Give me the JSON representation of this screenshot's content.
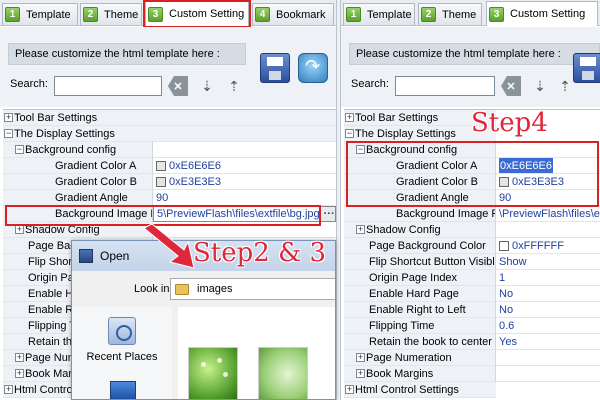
{
  "left": {
    "tabs": [
      {
        "num": "1",
        "label": "Template"
      },
      {
        "num": "2",
        "label": "Theme"
      },
      {
        "num": "3",
        "label": "Custom Setting"
      },
      {
        "num": "4",
        "label": "Bookmark"
      }
    ],
    "hint": "Please customize the html template here :",
    "search_label": "Search:",
    "search_value": "",
    "rows": [
      {
        "level": 0,
        "toggle": "+",
        "name": "Tool Bar Settings",
        "value": ""
      },
      {
        "level": 0,
        "toggle": "−",
        "name": "The Display Settings",
        "value": ""
      },
      {
        "level": 1,
        "toggle": "−",
        "name": "Background config",
        "value": ""
      },
      {
        "level": 2,
        "toggle": "",
        "name": "Gradient Color A",
        "value": "0xE6E6E6",
        "swatch": "#E6E6E6"
      },
      {
        "level": 2,
        "toggle": "",
        "name": "Gradient Color B",
        "value": "0xE3E3E3",
        "swatch": "#E3E3E3"
      },
      {
        "level": 2,
        "toggle": "",
        "name": "Gradient Angle",
        "value": "90"
      },
      {
        "level": 2,
        "toggle": "",
        "name": "Background Image File",
        "value": "5\\PreviewFlash\\files\\extfile\\bg.jpg"
      },
      {
        "level": 1,
        "toggle": "+",
        "name": "Shadow Config",
        "value": ""
      },
      {
        "level": 1,
        "toggle": "",
        "name": "Page Back",
        "value": ""
      },
      {
        "level": 1,
        "toggle": "",
        "name": "Flip Shor",
        "value": ""
      },
      {
        "level": 1,
        "toggle": "",
        "name": "Origin Pag",
        "value": ""
      },
      {
        "level": 1,
        "toggle": "",
        "name": "Enable Har",
        "value": ""
      },
      {
        "level": 1,
        "toggle": "",
        "name": "Enable Rig",
        "value": ""
      },
      {
        "level": 1,
        "toggle": "",
        "name": "Flipping Ti",
        "value": ""
      },
      {
        "level": 1,
        "toggle": "",
        "name": "Retain the",
        "value": ""
      },
      {
        "level": 1,
        "toggle": "+",
        "name": "Page Num",
        "value": ""
      },
      {
        "level": 1,
        "toggle": "+",
        "name": "Book Mar",
        "value": ""
      },
      {
        "level": 0,
        "toggle": "+",
        "name": "Html Contro",
        "value": ""
      }
    ],
    "step_label": "Step2 & 3"
  },
  "dialog": {
    "title": "Open",
    "look_in_label": "Look in:",
    "look_in_value": "images",
    "place_label": "Recent Places"
  },
  "right": {
    "tabs": [
      {
        "num": "1",
        "label": "Template"
      },
      {
        "num": "2",
        "label": "Theme"
      },
      {
        "num": "3",
        "label": "Custom Setting"
      }
    ],
    "hint": "Please customize the html template here :",
    "search_label": "Search:",
    "search_value": "",
    "rows": [
      {
        "level": 0,
        "toggle": "+",
        "name": "Tool Bar Settings",
        "value": ""
      },
      {
        "level": 0,
        "toggle": "−",
        "name": "The Display Settings",
        "value": ""
      },
      {
        "level": 1,
        "toggle": "−",
        "name": "Background config",
        "value": ""
      },
      {
        "level": 2,
        "toggle": "",
        "name": "Gradient Color A",
        "value": "0xE6E6E6",
        "editing": true
      },
      {
        "level": 2,
        "toggle": "",
        "name": "Gradient Color B",
        "value": "0xE3E3E3",
        "swatch": "#E3E3E3"
      },
      {
        "level": 2,
        "toggle": "",
        "name": "Gradient Angle",
        "value": "90"
      },
      {
        "level": 2,
        "toggle": "",
        "name": "Background Image File",
        "value": "\\PreviewFlash\\files\\ex"
      },
      {
        "level": 1,
        "toggle": "+",
        "name": "Shadow Config",
        "value": ""
      },
      {
        "level": 1,
        "toggle": "",
        "name": "Page Background Color",
        "value": "0xFFFFFF",
        "swatch": "#FFFFFF"
      },
      {
        "level": 1,
        "toggle": "",
        "name": "Flip Shortcut Button Visible",
        "value": "Show"
      },
      {
        "level": 1,
        "toggle": "",
        "name": "Origin Page Index",
        "value": "1"
      },
      {
        "level": 1,
        "toggle": "",
        "name": "Enable Hard Page",
        "value": "No"
      },
      {
        "level": 1,
        "toggle": "",
        "name": "Enable Right to Left",
        "value": "No"
      },
      {
        "level": 1,
        "toggle": "",
        "name": "Flipping Time",
        "value": "0.6"
      },
      {
        "level": 1,
        "toggle": "",
        "name": "Retain the book to center",
        "value": "Yes"
      },
      {
        "level": 1,
        "toggle": "+",
        "name": "Page Numeration",
        "value": ""
      },
      {
        "level": 1,
        "toggle": "+",
        "name": "Book Margins",
        "value": ""
      },
      {
        "level": 0,
        "toggle": "+",
        "name": "Html Control Settings",
        "value": ""
      }
    ],
    "step_label": "Step4"
  },
  "colors": {
    "annotation_red": "#d92121",
    "value_blue": "#1f3f9e",
    "tab_badge_green": "#5aa02c"
  }
}
